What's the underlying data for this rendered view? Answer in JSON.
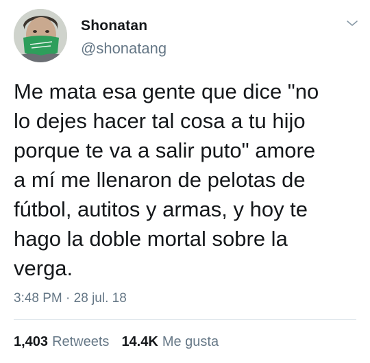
{
  "tweet": {
    "author": {
      "name": "Shonatan",
      "handle": "@shonatang",
      "avatar_icon": "user-avatar"
    },
    "text": "Me mata esa gente que dice \"no\nlo dejes hacer tal cosa a tu hijo\nporque te va a salir puto\" amore\na mí me llenaron de pelotas de\nfútbol, autitos y armas, y hoy te\nhago la doble mortal sobre la\nverga.",
    "time": "3:48 PM",
    "separator": " · ",
    "date": "28 jul. 18",
    "stats": {
      "retweets_count": "1,403",
      "retweets_label": "Retweets",
      "likes_count": "14.4K",
      "likes_label": "Me gusta"
    }
  },
  "colors": {
    "text": "#14171a",
    "secondary": "#657786",
    "divider": "#e1e8ed",
    "mask": "#2e9e5b"
  }
}
